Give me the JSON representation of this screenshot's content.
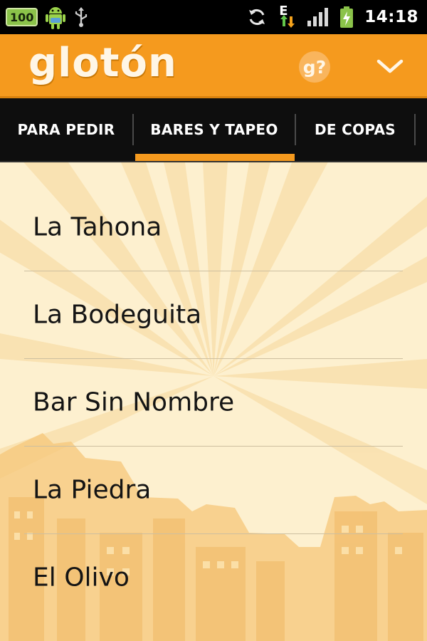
{
  "status_bar": {
    "battery_badge": "100",
    "time": "14:18",
    "network_type": "E",
    "icons": [
      "battery-badge-icon",
      "android-robot-icon",
      "usb-icon",
      "sync-icon",
      "data-arrows-icon",
      "signal-icon",
      "battery-icon"
    ]
  },
  "app": {
    "logo_text": "glotón",
    "help_icon": "g?",
    "colors": {
      "brand_orange": "#f59a1e",
      "tab_bg": "#0e0e0e",
      "content_bg": "#fdf0cf"
    }
  },
  "tabs": [
    {
      "label": "PARA PEDIR",
      "selected": false
    },
    {
      "label": "BARES Y TAPEO",
      "selected": true
    },
    {
      "label": "DE COPAS",
      "selected": false
    }
  ],
  "list": {
    "items": [
      {
        "label": "La Tahona"
      },
      {
        "label": "La Bodeguita"
      },
      {
        "label": "Bar Sin Nombre"
      },
      {
        "label": "La Piedra"
      },
      {
        "label": "El Olivo"
      }
    ]
  }
}
